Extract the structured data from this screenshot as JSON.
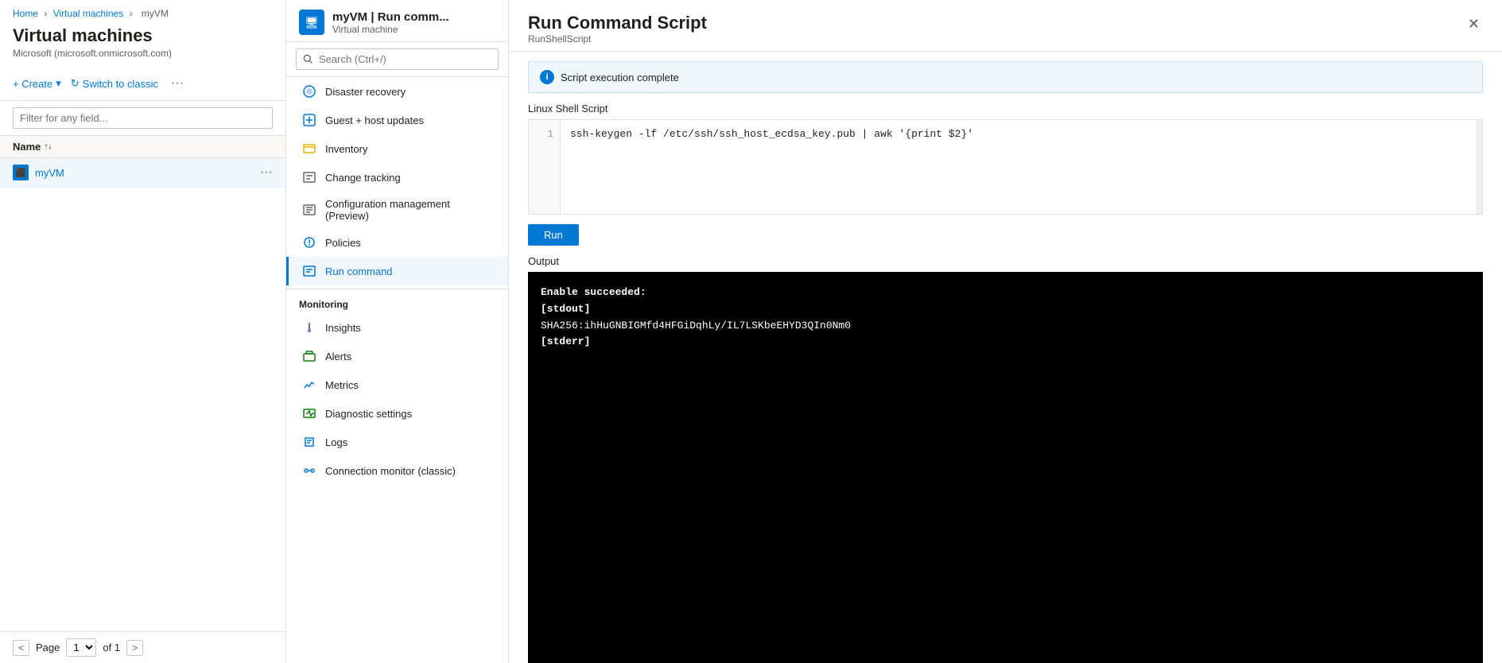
{
  "breadcrumb": {
    "home": "Home",
    "vms": "Virtual machines",
    "vm": "myVM",
    "separator": "›"
  },
  "left_panel": {
    "title": "Virtual machines",
    "subtitle": "Microsoft (microsoft.onmicrosoft.com)",
    "create_label": "+ Create",
    "switch_label": "Switch to classic",
    "more_label": "···",
    "filter_placeholder": "Filter for any field...",
    "table_header": "Name",
    "vm_name": "myVM",
    "page_label": "Page",
    "page_current": "1",
    "page_of": "of 1"
  },
  "mid_panel": {
    "vm_name": "myVM | Run comm...",
    "vm_type": "Virtual machine",
    "search_placeholder": "Search (Ctrl+/)",
    "nav_items": [
      {
        "label": "Disaster recovery",
        "icon": "disaster-icon",
        "active": false
      },
      {
        "label": "Guest + host updates",
        "icon": "updates-icon",
        "active": false
      },
      {
        "label": "Inventory",
        "icon": "inventory-icon",
        "active": false
      },
      {
        "label": "Change tracking",
        "icon": "change-icon",
        "active": false
      },
      {
        "label": "Configuration management (Preview)",
        "icon": "config-icon",
        "active": false
      },
      {
        "label": "Policies",
        "icon": "policies-icon",
        "active": false
      },
      {
        "label": "Run command",
        "icon": "run-icon",
        "active": true
      }
    ],
    "monitoring_label": "Monitoring",
    "monitoring_items": [
      {
        "label": "Insights",
        "icon": "insights-icon",
        "active": false
      },
      {
        "label": "Alerts",
        "icon": "alerts-icon",
        "active": false
      },
      {
        "label": "Metrics",
        "icon": "metrics-icon",
        "active": false
      },
      {
        "label": "Diagnostic settings",
        "icon": "diagnostic-icon",
        "active": false
      },
      {
        "label": "Logs",
        "icon": "logs-icon",
        "active": false
      },
      {
        "label": "Connection monitor (classic)",
        "icon": "connection-icon",
        "active": false
      }
    ]
  },
  "right_panel": {
    "title": "Run Command Script",
    "subtitle": "RunShellScript",
    "info_message": "Script execution complete",
    "script_section_label": "Linux Shell Script",
    "line_number": "1",
    "script_code": "ssh-keygen -lf /etc/ssh/ssh_host_ecdsa_key.pub | awk '{print $2}'",
    "run_button": "Run",
    "output_label": "Output",
    "output_lines": [
      "Enable succeeded:",
      "[stdout]",
      "SHA256:ihHuGNBIGMfd4HFGiDqhLy/IL7LSKbeEHYD3QIn0Nm0",
      "",
      "[stderr]"
    ]
  }
}
